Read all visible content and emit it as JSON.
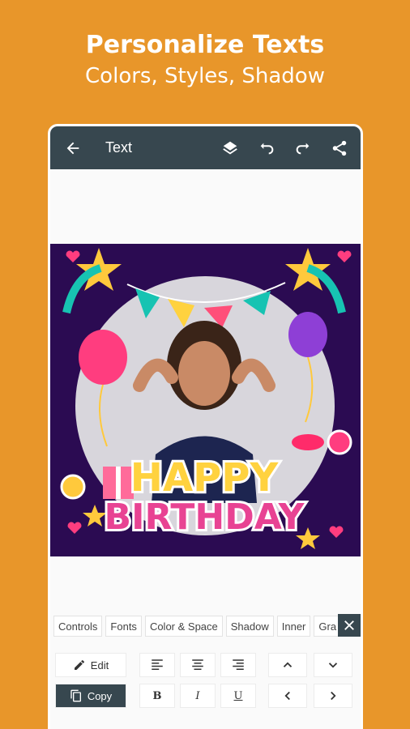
{
  "promo": {
    "title": "Personalize Texts",
    "subtitle": "Colors, Styles, Shadow"
  },
  "appbar": {
    "title": "Text",
    "icons": [
      "back-arrow-icon",
      "layers-icon",
      "undo-icon",
      "redo-icon",
      "share-icon"
    ],
    "background": "#37474F"
  },
  "canvas": {
    "text_line1": "HAPPY",
    "text_line2": "BIRTHDAY",
    "background": "#2b0b52"
  },
  "tabs": [
    "Controls",
    "Fonts",
    "Color & Space",
    "Shadow",
    "Inner",
    "Gra"
  ],
  "buttons": {
    "edit": "Edit",
    "copy": "Copy",
    "bold": "B",
    "italic": "I",
    "underline": "U"
  },
  "colors": {
    "page_background": "#E8962A",
    "accent_dark": "#37474F"
  }
}
